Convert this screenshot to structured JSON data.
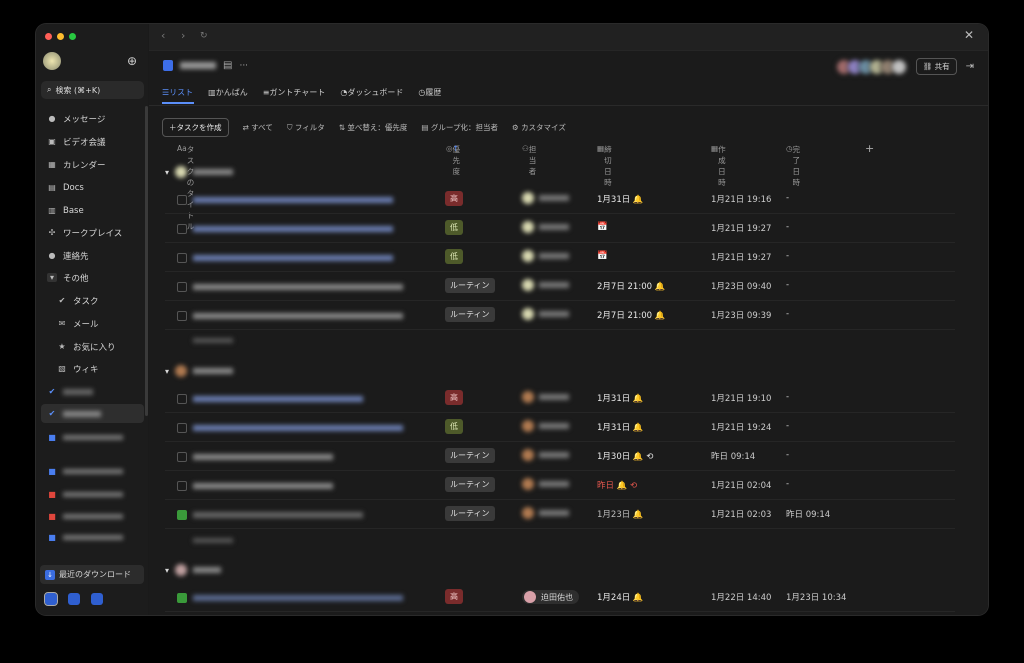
{
  "sidebar": {
    "search_label": "検索 (⌘+K)",
    "items": [
      {
        "label": "メッセージ",
        "icon": "chat-icon"
      },
      {
        "label": "ビデオ会議",
        "icon": "video-icon"
      },
      {
        "label": "カレンダー",
        "icon": "calendar-icon"
      },
      {
        "label": "Docs",
        "icon": "docs-icon"
      },
      {
        "label": "Base",
        "icon": "base-icon"
      },
      {
        "label": "ワークプレイス",
        "icon": "workplace-icon"
      },
      {
        "label": "連絡先",
        "icon": "contacts-icon"
      },
      {
        "label": "その他",
        "icon": "chevron-down-icon"
      },
      {
        "label": "タスク",
        "icon": "check-icon"
      },
      {
        "label": "メール",
        "icon": "mail-icon"
      },
      {
        "label": "お気に入り",
        "icon": "star-icon"
      },
      {
        "label": "ウィキ",
        "icon": "wiki-icon"
      }
    ],
    "download_label": "最近のダウンロード"
  },
  "main": {
    "tabs": [
      "リスト",
      "かんばん",
      "ガントチャート",
      "ダッシュボード",
      "履歴"
    ],
    "share_label": "共有",
    "toolbar": {
      "create": "＋タスクを作成",
      "all": "すべて",
      "filter": "フィルタ",
      "sort": "並べ替え：優先度",
      "group": "グループ化：担当者",
      "customize": "カスタマイズ"
    },
    "columns": {
      "title": "タスクのタイトル",
      "priority": "優先度",
      "owner": "担当者",
      "due": "締切日時",
      "created": "作成日時",
      "done": "完了日時"
    },
    "rows": [
      {
        "priority": "高",
        "due": "1月31日 🔔",
        "created": "1月21日 19:16",
        "done": "-"
      },
      {
        "priority": "低",
        "due": "📅",
        "created": "1月21日 19:27",
        "done": "-"
      },
      {
        "priority": "低",
        "due": "📅",
        "created": "1月21日 19:27",
        "done": "-"
      },
      {
        "priority": "ルーティン",
        "due": "2月7日 21:00 🔔",
        "created": "1月23日 09:40",
        "done": "-"
      },
      {
        "priority": "ルーティン",
        "due": "2月7日 21:00 🔔",
        "created": "1月23日 09:39",
        "done": "-"
      },
      {
        "priority": "高",
        "due": "1月31日 🔔",
        "created": "1月21日 19:10",
        "done": "-"
      },
      {
        "priority": "低",
        "due": "1月31日 🔔",
        "created": "1月21日 19:24",
        "done": "-"
      },
      {
        "priority": "ルーティン",
        "due": "1月30日 🔔 ⟲",
        "created": "昨日 09:14",
        "done": "-"
      },
      {
        "priority": "ルーティン",
        "due": "昨日 🔔 ⟲",
        "created": "1月21日 02:04",
        "done": "-"
      },
      {
        "priority": "ルーティン",
        "due": "1月23日 🔔",
        "created": "1月21日 02:03",
        "done": "昨日 09:14"
      },
      {
        "priority": "高",
        "owner": "迫田佑也",
        "due": "1月24日 🔔",
        "created": "1月22日 14:40",
        "done": "1月23日 10:34"
      }
    ]
  },
  "colors": {
    "accent": "#5b8ff9",
    "high": "#7a2c2c",
    "low": "#4e5a2a",
    "overdue": "#e2564d"
  }
}
